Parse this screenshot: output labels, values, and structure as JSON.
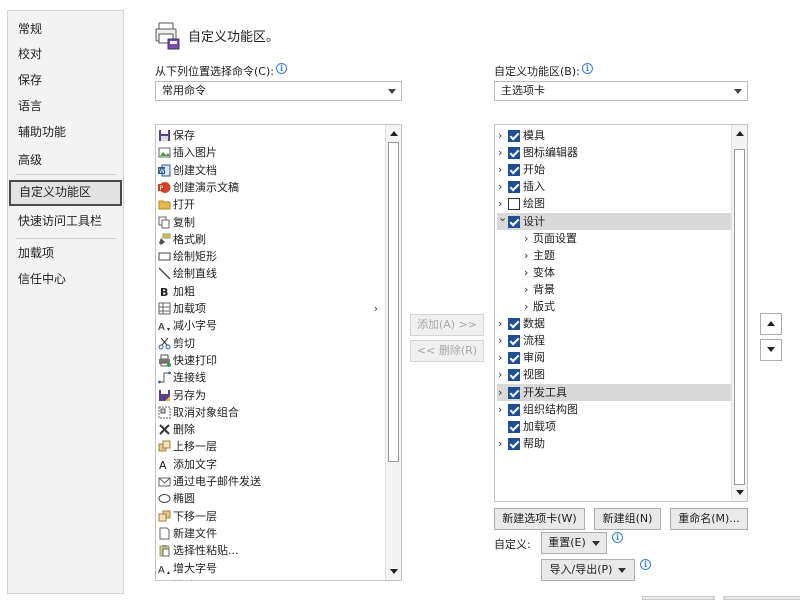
{
  "nav": {
    "items": [
      "常规",
      "校对",
      "保存",
      "语言",
      "辅助功能",
      "高级",
      "自定义功能区",
      "快速访问工具栏",
      "加载项",
      "信任中心"
    ],
    "selected": "自定义功能区"
  },
  "header": {
    "title": "自定义功能区。"
  },
  "left_panel": {
    "label": "从下列位置选择命令(C):",
    "combo_value": "常用命令",
    "commands": [
      {
        "label": "保存",
        "icon": "save-icon"
      },
      {
        "label": "插入图片",
        "icon": "picture-icon"
      },
      {
        "label": "创建文档",
        "icon": "word-icon"
      },
      {
        "label": "创建演示文稿",
        "icon": "powerpoint-icon"
      },
      {
        "label": "打开",
        "icon": "folder-open-icon"
      },
      {
        "label": "复制",
        "icon": "copy-icon"
      },
      {
        "label": "格式刷",
        "icon": "format-painter-icon"
      },
      {
        "label": "绘制矩形",
        "icon": "rectangle-icon"
      },
      {
        "label": "绘制直线",
        "icon": "line-icon"
      },
      {
        "label": "加粗",
        "icon": "bold-icon"
      },
      {
        "label": "加载项",
        "icon": "addins-icon",
        "submenu": true
      },
      {
        "label": "减小字号",
        "icon": "decrease-font-icon"
      },
      {
        "label": "剪切",
        "icon": "cut-icon"
      },
      {
        "label": "快速打印",
        "icon": "quick-print-icon"
      },
      {
        "label": "连接线",
        "icon": "connector-icon"
      },
      {
        "label": "另存为",
        "icon": "save-as-icon"
      },
      {
        "label": "取消对象组合",
        "icon": "ungroup-icon"
      },
      {
        "label": "删除",
        "icon": "delete-icon"
      },
      {
        "label": "上移一层",
        "icon": "bring-forward-icon"
      },
      {
        "label": "添加文字",
        "icon": "add-text-icon"
      },
      {
        "label": "通过电子邮件发送",
        "icon": "email-icon"
      },
      {
        "label": "椭圆",
        "icon": "ellipse-icon"
      },
      {
        "label": "下移一层",
        "icon": "send-backward-icon"
      },
      {
        "label": "新建文件",
        "icon": "new-file-icon"
      },
      {
        "label": "选择性粘贴...",
        "icon": "paste-special-icon"
      },
      {
        "label": "增大字号",
        "icon": "increase-font-icon"
      },
      {
        "label": "粘贴",
        "icon": "paste-icon"
      }
    ]
  },
  "middle": {
    "add_label": "添加(A) >>",
    "remove_label": "<< 删除(R)"
  },
  "right_panel": {
    "label": "自定义功能区(B):",
    "combo_value": "主选项卡",
    "tree": [
      {
        "label": "模具",
        "checked": true,
        "level": 0,
        "expander": "collapsed"
      },
      {
        "label": "图标编辑器",
        "checked": true,
        "level": 0,
        "expander": "collapsed"
      },
      {
        "label": "开始",
        "checked": true,
        "level": 0,
        "expander": "collapsed"
      },
      {
        "label": "插入",
        "checked": true,
        "level": 0,
        "expander": "collapsed"
      },
      {
        "label": "绘图",
        "checked": false,
        "level": 0,
        "expander": "collapsed"
      },
      {
        "label": "设计",
        "checked": true,
        "level": 0,
        "expander": "expanded",
        "highlight": true
      },
      {
        "label": "页面设置",
        "level": 1,
        "expander": "collapsed"
      },
      {
        "label": "主题",
        "level": 1,
        "expander": "collapsed"
      },
      {
        "label": "变体",
        "level": 1,
        "expander": "collapsed"
      },
      {
        "label": "背景",
        "level": 1,
        "expander": "collapsed"
      },
      {
        "label": "版式",
        "level": 1,
        "expander": "collapsed"
      },
      {
        "label": "数据",
        "checked": true,
        "level": 0,
        "expander": "collapsed"
      },
      {
        "label": "流程",
        "checked": true,
        "level": 0,
        "expander": "collapsed"
      },
      {
        "label": "审阅",
        "checked": true,
        "level": 0,
        "expander": "collapsed"
      },
      {
        "label": "视图",
        "checked": true,
        "level": 0,
        "expander": "collapsed"
      },
      {
        "label": "开发工具",
        "checked": true,
        "level": 0,
        "expander": "collapsed",
        "highlight": true
      },
      {
        "label": "组织结构图",
        "checked": true,
        "level": 0,
        "expander": "collapsed"
      },
      {
        "label": "加载项",
        "checked": true,
        "level": 0,
        "expander": "none"
      },
      {
        "label": "帮助",
        "checked": true,
        "level": 0,
        "expander": "collapsed"
      }
    ],
    "new_tab_label": "新建选项卡(W)",
    "new_group_label": "新建组(N)",
    "rename_label": "重命名(M)...",
    "customize_label": "自定义:",
    "reset_label": "重置(E)",
    "import_export_label": "导入/导出(P)"
  },
  "colors": {
    "checkbox_accent": "#1f4e91",
    "info_icon": "#3b7fd1",
    "selection": "#d9d9d9"
  }
}
